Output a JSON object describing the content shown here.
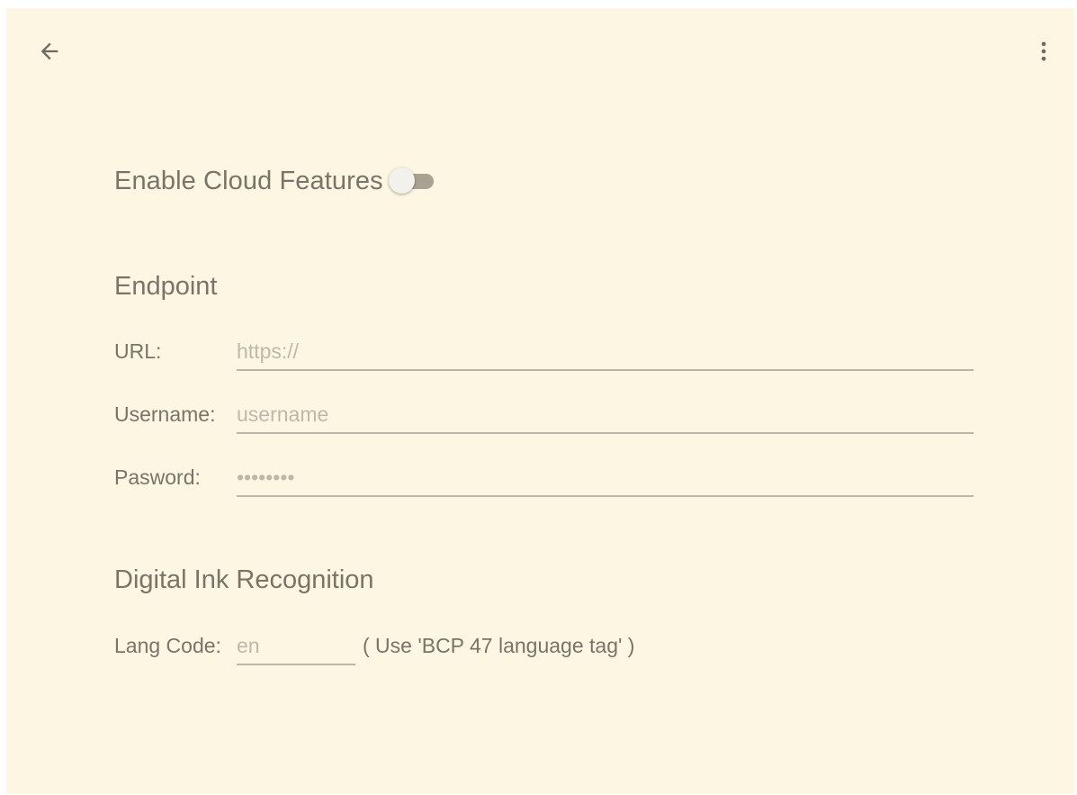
{
  "toolbar": {
    "back_icon": "arrow-left-icon",
    "more_icon": "more-vert-icon"
  },
  "cloud": {
    "label": "Enable Cloud Features",
    "enabled": false
  },
  "endpoint": {
    "title": "Endpoint",
    "url": {
      "label": "URL:",
      "value": "",
      "placeholder": "https://"
    },
    "username": {
      "label": "Username:",
      "value": "",
      "placeholder": "username"
    },
    "password": {
      "label": "Pasword:",
      "value": "",
      "placeholder": "••••••••"
    }
  },
  "ink": {
    "title": "Digital Ink Recognition",
    "lang": {
      "label": "Lang Code:",
      "value": "",
      "placeholder": "en"
    },
    "hint": "( Use 'BCP 47 language tag' )"
  },
  "colors": {
    "background": "#fdf6e3",
    "text": "#7a7468",
    "placeholder": "#bfb8aa",
    "underline": "#bdb6a8",
    "switch_track": "#a9a192",
    "switch_thumb": "#f3f1ec"
  }
}
